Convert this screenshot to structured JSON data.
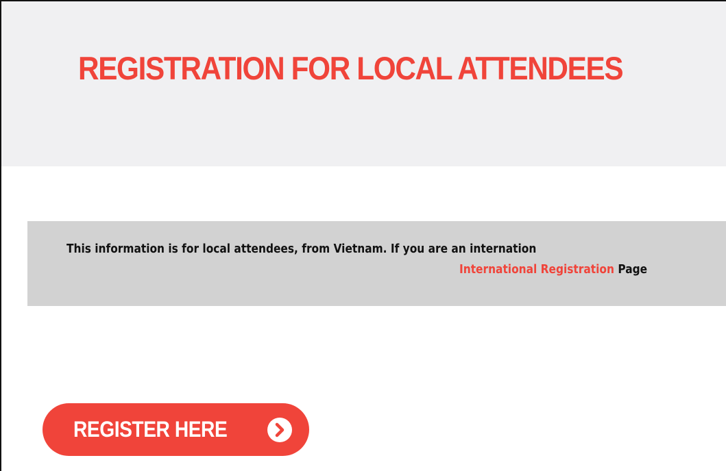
{
  "header": {
    "title": "REGISTRATION FOR LOCAL ATTENDEES"
  },
  "notice": {
    "line1": "This information is for local attendees, from Vietnam. If you are an internation",
    "link_text": "International Registration",
    "line2_suffix": " Page"
  },
  "register_button": {
    "label": "REGISTER HERE",
    "icon": "chevron-right-circle-icon"
  },
  "colors": {
    "accent": "#f0443a",
    "hero_background": "#f0f0f2",
    "notice_background": "#d2d2d2",
    "text_dark": "#111111",
    "button_text": "#ffffff"
  }
}
